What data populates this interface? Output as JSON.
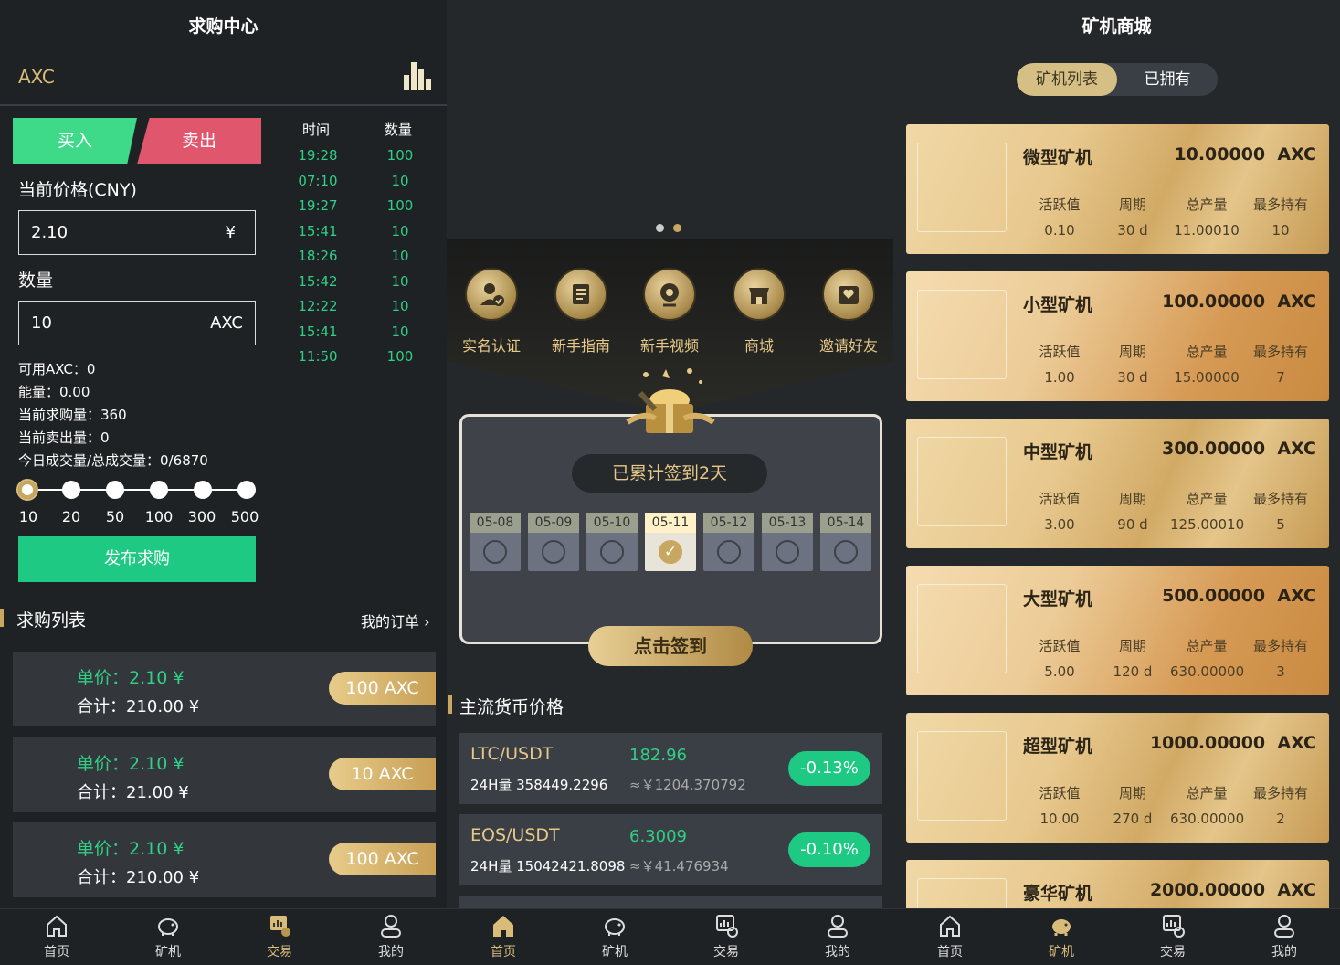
{
  "p1": {
    "title": "求购中心",
    "symbol": "AXC",
    "buy": "买入",
    "sell": "卖出",
    "price_label": "当前价格(CNY)",
    "price_value": "2.10",
    "price_unit": "¥",
    "qty_label": "数量",
    "qty_value": "10",
    "qty_unit": "AXC",
    "info": [
      "可用AXC：0",
      "能量：0.00",
      "当前求购量：360",
      "当前卖出量：0",
      "今日成交量/总成交量：0/6870"
    ],
    "trade_head": {
      "time": "时间",
      "qty": "数量"
    },
    "trades": [
      [
        "19:28",
        "100"
      ],
      [
        "07:10",
        "10"
      ],
      [
        "19:27",
        "100"
      ],
      [
        "15:41",
        "10"
      ],
      [
        "18:26",
        "10"
      ],
      [
        "15:42",
        "10"
      ],
      [
        "12:22",
        "10"
      ],
      [
        "15:41",
        "10"
      ],
      [
        "11:50",
        "100"
      ]
    ],
    "slider": [
      "10",
      "20",
      "50",
      "100",
      "300",
      "500"
    ],
    "publish": "发布求购",
    "list_title": "求购列表",
    "my_orders": "我的订单 ›",
    "orders": [
      {
        "price": "单价：2.10 ¥",
        "total": "合计：210.00 ¥",
        "amount": "100 AXC"
      },
      {
        "price": "单价：2.10 ¥",
        "total": "合计：21.00 ¥",
        "amount": "10 AXC"
      },
      {
        "price": "单价：2.10 ¥",
        "total": "合计：210.00 ¥",
        "amount": "100 AXC"
      }
    ]
  },
  "p2": {
    "quick": [
      "实名认证",
      "新手指南",
      "新手视频",
      "商城",
      "邀请好友"
    ],
    "sign_count": "已累计签到2天",
    "days": [
      "05-08",
      "05-09",
      "05-10",
      "05-11",
      "05-12",
      "05-13",
      "05-14"
    ],
    "sign_btn": "点击签到",
    "market_title": "主流货币价格",
    "coins": [
      {
        "pair": "LTC/USDT",
        "vol": "24H量 358449.2296",
        "price": "182.96",
        "cny": "≈￥1204.370792",
        "chg": "-0.13%"
      },
      {
        "pair": "EOS/USDT",
        "vol": "24H量 15042421.8098",
        "price": "6.3009",
        "cny": "≈￥41.476934",
        "chg": "-0.10%"
      }
    ]
  },
  "p3": {
    "title": "矿机商城",
    "tab1": "矿机列表",
    "tab2": "已拥有",
    "heads": [
      "活跃值",
      "周期",
      "总产量",
      "最多持有"
    ],
    "miners": [
      {
        "name": "微型矿机",
        "price": "10.00000  AXC",
        "vals": [
          "0.10",
          "30 d",
          "11.00010",
          "10"
        ]
      },
      {
        "name": "小型矿机",
        "price": "100.00000  AXC",
        "vals": [
          "1.00",
          "30 d",
          "15.00000",
          "7"
        ]
      },
      {
        "name": "中型矿机",
        "price": "300.00000  AXC",
        "vals": [
          "3.00",
          "90 d",
          "125.00010",
          "5"
        ]
      },
      {
        "name": "大型矿机",
        "price": "500.00000  AXC",
        "vals": [
          "5.00",
          "120 d",
          "630.00000",
          "3"
        ]
      },
      {
        "name": "超型矿机",
        "price": "1000.00000  AXC",
        "vals": [
          "10.00",
          "270 d",
          "630.00000",
          "2"
        ]
      },
      {
        "name": "豪华矿机",
        "price": "2000.00000  AXC"
      }
    ]
  },
  "nav": [
    "首页",
    "矿机",
    "交易",
    "我的"
  ]
}
